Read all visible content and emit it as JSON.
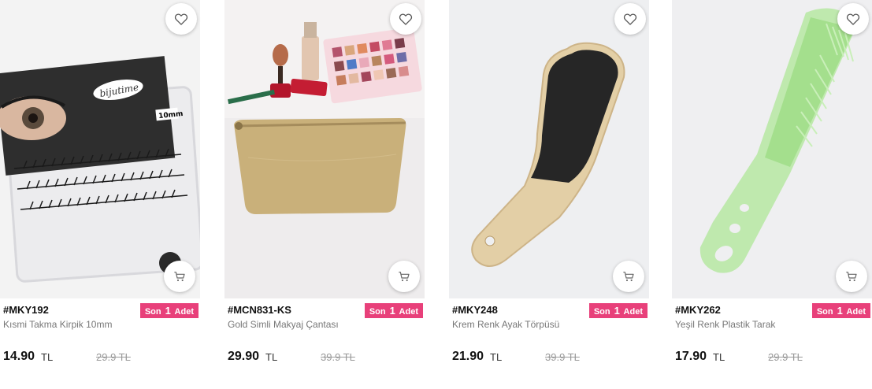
{
  "products": [
    {
      "code": "#MKY192",
      "name": "Kısmi Takma Kirpik 10mm",
      "badge": {
        "prefix": "Son",
        "count": "1",
        "suffix": "Adet"
      },
      "price": "14.90",
      "currency": "TL",
      "old_price": "29.9 TL",
      "brand_text": "bijutime",
      "size_text": "10mm"
    },
    {
      "code": "#MCN831-KS",
      "name": "Gold Simli Makyaj Çantası",
      "badge": {
        "prefix": "Son",
        "count": "1",
        "suffix": "Adet"
      },
      "price": "29.90",
      "currency": "TL",
      "old_price": "39.9 TL"
    },
    {
      "code": "#MKY248",
      "name": "Krem Renk Ayak Törpüsü",
      "badge": {
        "prefix": "Son",
        "count": "1",
        "suffix": "Adet"
      },
      "price": "21.90",
      "currency": "TL",
      "old_price": "39.9 TL"
    },
    {
      "code": "#MKY262",
      "name": "Yeşil Renk Plastik Tarak",
      "badge": {
        "prefix": "Son",
        "count": "1",
        "suffix": "Adet"
      },
      "price": "17.90",
      "currency": "TL",
      "old_price": "29.9 TL"
    }
  ],
  "icons": {
    "favorite": "heart-icon",
    "cart": "cart-icon"
  },
  "colors": {
    "badge": "#e8407a"
  }
}
